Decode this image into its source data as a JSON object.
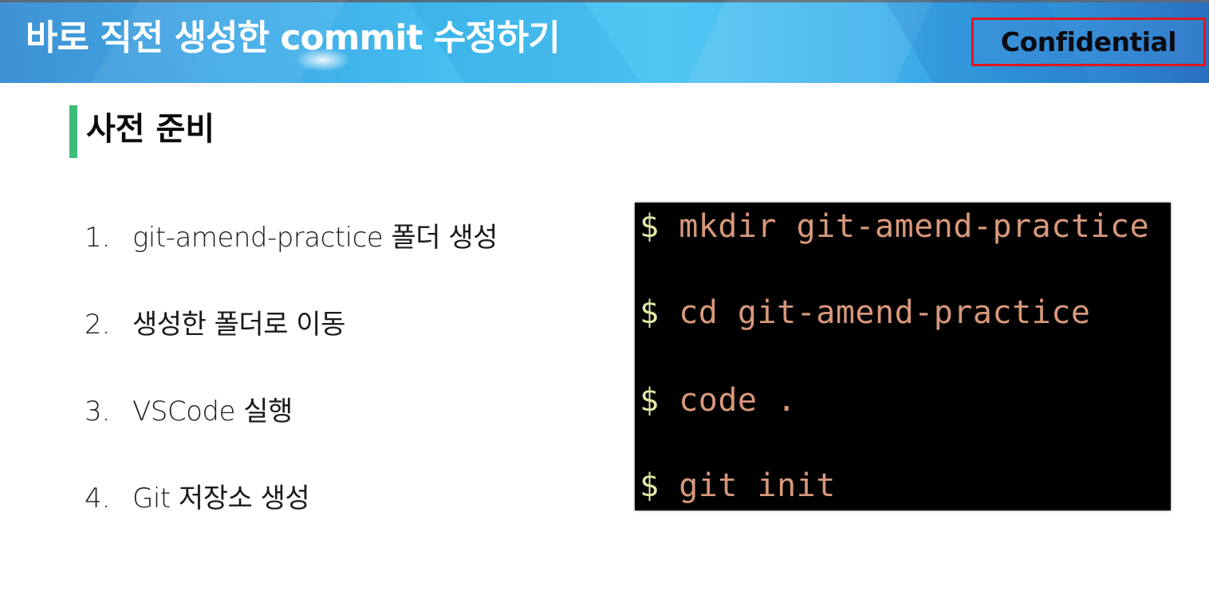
{
  "header": {
    "title": "바로 직전 생성한 commit 수정하기",
    "badge": "Confidential"
  },
  "section": {
    "title": "사전 준비"
  },
  "steps": [
    {
      "number": "1.",
      "text": "git-amend-practice 폴더 생성"
    },
    {
      "number": "2.",
      "text": "생성한 폴더로 이동"
    },
    {
      "number": "3.",
      "text": "VSCode 실행"
    },
    {
      "number": "4.",
      "text": "Git 저장소 생성"
    }
  ],
  "terminal": {
    "prompt": "$",
    "commands": [
      "mkdir git-amend-practice",
      "cd git-amend-practice",
      "code .",
      "git init"
    ]
  },
  "colors": {
    "header_gradient_start": "#2a86cf",
    "header_gradient_mid": "#52c6f3",
    "section_bar": "#3dbb7b",
    "badge_border": "#e0161b",
    "terminal_bg": "#000000",
    "terminal_prompt": "#e4e6a6",
    "terminal_text": "#d7987a"
  }
}
